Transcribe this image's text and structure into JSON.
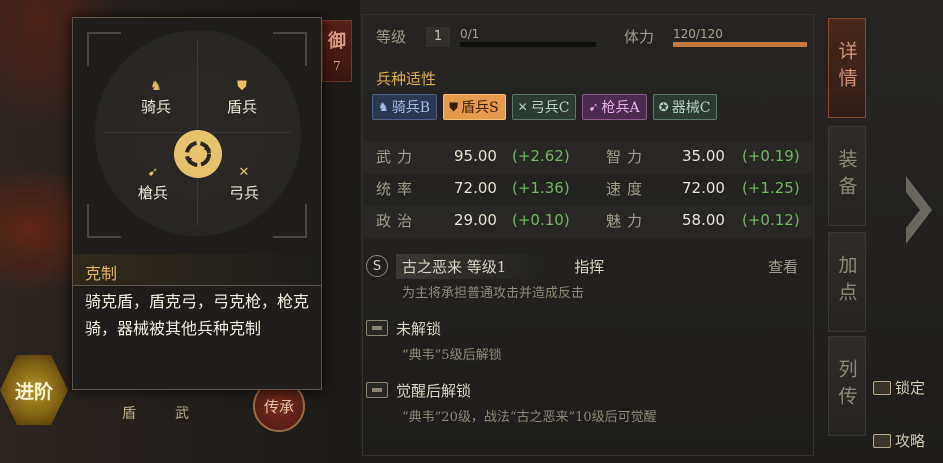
{
  "popup": {
    "units": {
      "cavalry": "骑兵",
      "shield": "盾兵",
      "spear": "槍兵",
      "bow": "弓兵"
    },
    "title": "克制",
    "description": "骑克盾，盾克弓，弓克枪，枪克骑，器械被其他兵种克制"
  },
  "left": {
    "advance_label": "进阶",
    "tabs": [
      "盾",
      "武"
    ],
    "inherit_label": "传承",
    "defense_label": "御",
    "defense_value": "7"
  },
  "header": {
    "level_label": "等级",
    "level_value": "1",
    "exp_text": "0/1",
    "exp_progress": 0,
    "stamina_label": "体力",
    "stamina_text": "120/120",
    "stamina_progress": 1.0
  },
  "fitness": {
    "label": "兵种适性",
    "tags": [
      {
        "icon": "cavalry-icon",
        "label": "骑兵B"
      },
      {
        "icon": "shield-icon",
        "label": "盾兵S"
      },
      {
        "icon": "bow-icon",
        "label": "弓兵C"
      },
      {
        "icon": "spear-icon",
        "label": "枪兵A"
      },
      {
        "icon": "siege-icon",
        "label": "器械C"
      }
    ]
  },
  "stats": [
    {
      "name": "武力",
      "value": "95.00",
      "bonus": "(+2.62)"
    },
    {
      "name": "智力",
      "value": "35.00",
      "bonus": "(+0.19)"
    },
    {
      "name": "统率",
      "value": "72.00",
      "bonus": "(+1.36)"
    },
    {
      "name": "速度",
      "value": "72.00",
      "bonus": "(+1.25)"
    },
    {
      "name": "政治",
      "value": "29.00",
      "bonus": "(+0.10)"
    },
    {
      "name": "魅力",
      "value": "58.00",
      "bonus": "(+0.12)"
    }
  ],
  "skills": [
    {
      "icon_text": "S",
      "name": "古之恶来 等级1",
      "type": "指挥",
      "view": "查看",
      "desc": "为主将承担普通攻击并造成反击"
    },
    {
      "name": "未解锁",
      "desc": "“典韦”5级后解锁"
    },
    {
      "name": "觉醒后解锁",
      "desc": "“典韦”20级，战法“古之恶来”10级后可觉醒"
    }
  ],
  "side_tabs": [
    "详情",
    "装备",
    "加点",
    "列传"
  ],
  "side_links": {
    "lock": "锁定",
    "guide": "攻略"
  },
  "colors": {
    "accent": "#dfb04a",
    "bonus_green": "#6fb85c",
    "active_tab": "#d39276"
  }
}
